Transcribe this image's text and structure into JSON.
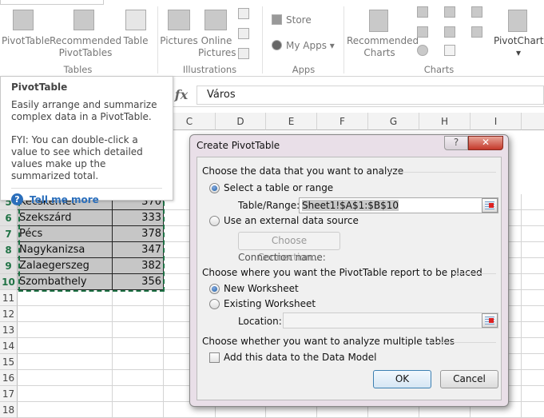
{
  "ribbon": {
    "buttons": {
      "pivottable": "PivotTable",
      "recommended_pivottables_1": "Recommended",
      "recommended_pivottables_2": "PivotTables",
      "table": "Table",
      "pictures": "Pictures",
      "online_pictures_1": "Online",
      "online_pictures_2": "Pictures",
      "store": "Store",
      "my_apps": "My Apps",
      "recommended_charts_1": "Recommended",
      "recommended_charts_2": "Charts",
      "pivotchart": "PivotChart"
    },
    "groups": {
      "tables": "Tables",
      "illustrations": "Illustrations",
      "apps": "Apps",
      "charts": "Charts"
    }
  },
  "formula_bar": {
    "fx": "fx",
    "value": "Város"
  },
  "tooltip": {
    "title": "PivotTable",
    "desc": "Easily arrange and summarize complex data in a PivotTable.",
    "fyi": "FYI: You can double-click a value to see which detailed values make up the summarized total.",
    "link": "Tell me more"
  },
  "sheet": {
    "columns": [
      "C",
      "D",
      "E",
      "F",
      "G",
      "H",
      "I"
    ],
    "rows": [
      {
        "num": "5",
        "city": "Kecskemét",
        "value": "370"
      },
      {
        "num": "6",
        "city": "Szekszárd",
        "value": "333"
      },
      {
        "num": "7",
        "city": "Pécs",
        "value": "378"
      },
      {
        "num": "8",
        "city": "Nagykanizsa",
        "value": "347"
      },
      {
        "num": "9",
        "city": "Zalaegerszeg",
        "value": "382"
      },
      {
        "num": "10",
        "city": "Szombathely",
        "value": "356"
      }
    ],
    "empty_rows": [
      "11",
      "12",
      "13",
      "14",
      "15",
      "16",
      "17",
      "18"
    ]
  },
  "dialog": {
    "title": "Create PivotTable",
    "help": "?",
    "close": "✕",
    "section1": "Choose the data that you want to analyze",
    "opt_select": "Select a table or range",
    "table_range_label": "Table/Range:",
    "table_range_value": "Sheet1!$A$1:$B$10",
    "opt_external": "Use an external data source",
    "choose_connection": "Choose Connection...",
    "connection_name": "Connection name:",
    "section2": "Choose where you want the PivotTable report to be placed",
    "opt_new": "New Worksheet",
    "opt_existing": "Existing Worksheet",
    "location_label": "Location:",
    "location_value": "",
    "section3": "Choose whether you want to analyze multiple tables",
    "add_data_model": "Add this data to the Data Model",
    "ok": "OK",
    "cancel": "Cancel"
  },
  "colors": {
    "accent": "#217346",
    "selection_border": "#1e7145",
    "link": "#2a6ebb"
  }
}
